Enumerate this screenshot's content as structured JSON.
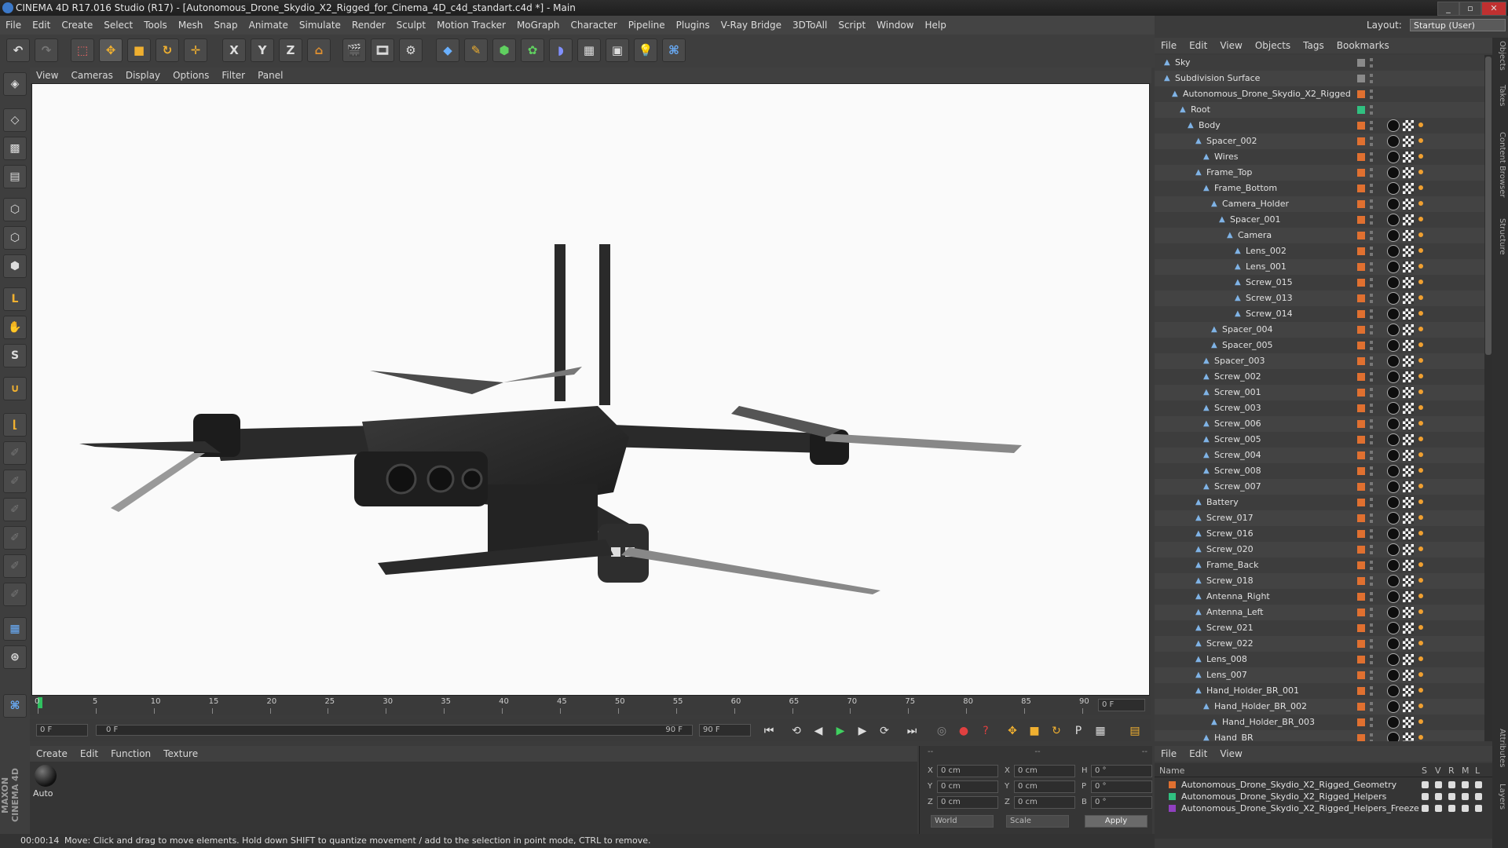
{
  "window": {
    "title": "CINEMA 4D R17.016 Studio (R17) - [Autonomous_Drone_Skydio_X2_Rigged_for_Cinema_4D_c4d_standart.c4d *] - Main"
  },
  "menubar": [
    "File",
    "Edit",
    "Create",
    "Select",
    "Tools",
    "Mesh",
    "Snap",
    "Animate",
    "Simulate",
    "Render",
    "Sculpt",
    "Motion Tracker",
    "MoGraph",
    "Character",
    "Pipeline",
    "Plugins",
    "V-Ray Bridge",
    "3DToAll",
    "Script",
    "Window",
    "Help"
  ],
  "layout": {
    "label": "Layout:",
    "value": "Startup (User)"
  },
  "toolbar": {
    "axis_x": "X",
    "axis_y": "Y",
    "axis_z": "Z"
  },
  "viewport": {
    "menu": [
      "View",
      "Cameras",
      "Display",
      "Options",
      "Filter",
      "Panel"
    ]
  },
  "timeline": {
    "ticks": [
      "0",
      "5",
      "10",
      "15",
      "20",
      "25",
      "30",
      "35",
      "40",
      "45",
      "50",
      "55",
      "60",
      "65",
      "70",
      "75",
      "80",
      "85",
      "90"
    ],
    "current_frame": "0 F",
    "start_field": "0 F",
    "range_start": "0 F",
    "range_end": "90 F",
    "end_field": "90 F"
  },
  "material_manager": {
    "menu": [
      "Create",
      "Edit",
      "Function",
      "Texture"
    ],
    "material_name": "Auto"
  },
  "coordinates": {
    "header": [
      "--",
      "--",
      "--"
    ],
    "rows": [
      {
        "a": "X",
        "av": "0 cm",
        "b": "X",
        "bv": "0 cm",
        "c": "H",
        "cv": "0 °"
      },
      {
        "a": "Y",
        "av": "0 cm",
        "b": "Y",
        "bv": "0 cm",
        "c": "P",
        "cv": "0 °"
      },
      {
        "a": "Z",
        "av": "0 cm",
        "b": "Z",
        "bv": "0 cm",
        "c": "B",
        "cv": "0 °"
      }
    ],
    "mode": "World",
    "scale": "Scale",
    "apply": "Apply"
  },
  "status": {
    "time": "00:00:14",
    "message": "Move: Click and drag to move elements. Hold down SHIFT to quantize movement / add to the selection in point mode, CTRL to remove."
  },
  "object_manager": {
    "menu": [
      "File",
      "Edit",
      "View",
      "Objects",
      "Tags",
      "Bookmarks"
    ],
    "rows": [
      {
        "name": "Sky",
        "depth": 0,
        "color": "#8a8a8a",
        "tags": false
      },
      {
        "name": "Subdivision Surface",
        "depth": 0,
        "color": "#8a8a8a",
        "tags": false
      },
      {
        "name": "Autonomous_Drone_Skydio_X2_Rigged",
        "depth": 1,
        "color": "#e07030",
        "tags": false
      },
      {
        "name": "Root",
        "depth": 2,
        "color": "#30c080",
        "tags": false
      },
      {
        "name": "Body",
        "depth": 3,
        "color": "#e07030",
        "tags": true
      },
      {
        "name": "Spacer_002",
        "depth": 4,
        "color": "#e07030",
        "tags": true
      },
      {
        "name": "Wires",
        "depth": 5,
        "color": "#e07030",
        "tags": true
      },
      {
        "name": "Frame_Top",
        "depth": 4,
        "color": "#e07030",
        "tags": true
      },
      {
        "name": "Frame_Bottom",
        "depth": 5,
        "color": "#e07030",
        "tags": true
      },
      {
        "name": "Camera_Holder",
        "depth": 6,
        "color": "#e07030",
        "tags": true
      },
      {
        "name": "Spacer_001",
        "depth": 7,
        "color": "#e07030",
        "tags": true
      },
      {
        "name": "Camera",
        "depth": 8,
        "color": "#e07030",
        "tags": true
      },
      {
        "name": "Lens_002",
        "depth": 9,
        "color": "#e07030",
        "tags": true
      },
      {
        "name": "Lens_001",
        "depth": 9,
        "color": "#e07030",
        "tags": true
      },
      {
        "name": "Screw_015",
        "depth": 9,
        "color": "#e07030",
        "tags": true
      },
      {
        "name": "Screw_013",
        "depth": 9,
        "color": "#e07030",
        "tags": true
      },
      {
        "name": "Screw_014",
        "depth": 9,
        "color": "#e07030",
        "tags": true
      },
      {
        "name": "Spacer_004",
        "depth": 6,
        "color": "#e07030",
        "tags": true
      },
      {
        "name": "Spacer_005",
        "depth": 6,
        "color": "#e07030",
        "tags": true
      },
      {
        "name": "Spacer_003",
        "depth": 5,
        "color": "#e07030",
        "tags": true
      },
      {
        "name": "Screw_002",
        "depth": 5,
        "color": "#e07030",
        "tags": true
      },
      {
        "name": "Screw_001",
        "depth": 5,
        "color": "#e07030",
        "tags": true
      },
      {
        "name": "Screw_003",
        "depth": 5,
        "color": "#e07030",
        "tags": true
      },
      {
        "name": "Screw_006",
        "depth": 5,
        "color": "#e07030",
        "tags": true
      },
      {
        "name": "Screw_005",
        "depth": 5,
        "color": "#e07030",
        "tags": true
      },
      {
        "name": "Screw_004",
        "depth": 5,
        "color": "#e07030",
        "tags": true
      },
      {
        "name": "Screw_008",
        "depth": 5,
        "color": "#e07030",
        "tags": true
      },
      {
        "name": "Screw_007",
        "depth": 5,
        "color": "#e07030",
        "tags": true
      },
      {
        "name": "Battery",
        "depth": 4,
        "color": "#e07030",
        "tags": true
      },
      {
        "name": "Screw_017",
        "depth": 4,
        "color": "#e07030",
        "tags": true
      },
      {
        "name": "Screw_016",
        "depth": 4,
        "color": "#e07030",
        "tags": true
      },
      {
        "name": "Screw_020",
        "depth": 4,
        "color": "#e07030",
        "tags": true
      },
      {
        "name": "Frame_Back",
        "depth": 4,
        "color": "#e07030",
        "tags": true
      },
      {
        "name": "Screw_018",
        "depth": 4,
        "color": "#e07030",
        "tags": true
      },
      {
        "name": "Antenna_Right",
        "depth": 4,
        "color": "#e07030",
        "tags": true
      },
      {
        "name": "Antenna_Left",
        "depth": 4,
        "color": "#e07030",
        "tags": true
      },
      {
        "name": "Screw_021",
        "depth": 4,
        "color": "#e07030",
        "tags": true
      },
      {
        "name": "Screw_022",
        "depth": 4,
        "color": "#e07030",
        "tags": true
      },
      {
        "name": "Lens_008",
        "depth": 4,
        "color": "#e07030",
        "tags": true
      },
      {
        "name": "Lens_007",
        "depth": 4,
        "color": "#e07030",
        "tags": true
      },
      {
        "name": "Hand_Holder_BR_001",
        "depth": 4,
        "color": "#e07030",
        "tags": true
      },
      {
        "name": "Hand_Holder_BR_002",
        "depth": 5,
        "color": "#e07030",
        "tags": true
      },
      {
        "name": "Hand_Holder_BR_003",
        "depth": 6,
        "color": "#e07030",
        "tags": true
      },
      {
        "name": "Hand_BR",
        "depth": 5,
        "color": "#e07030",
        "tags": true
      }
    ]
  },
  "side_tabs": [
    "Objects",
    "Takes",
    "Content Browser",
    "Structure",
    "Attributes",
    "Layers"
  ],
  "layer_manager": {
    "menu": [
      "File",
      "Edit",
      "View"
    ],
    "header": {
      "name": "Name",
      "s": "S",
      "v": "V",
      "r": "R",
      "m": "M",
      "l": "L"
    },
    "rows": [
      {
        "name": "Autonomous_Drone_Skydio_X2_Rigged_Geometry",
        "color": "#e07030"
      },
      {
        "name": "Autonomous_Drone_Skydio_X2_Rigged_Helpers",
        "color": "#30c080"
      },
      {
        "name": "Autonomous_Drone_Skydio_X2_Rigged_Helpers_Freeze",
        "color": "#9040c0"
      }
    ]
  },
  "branding": "MAXON CINEMA 4D"
}
